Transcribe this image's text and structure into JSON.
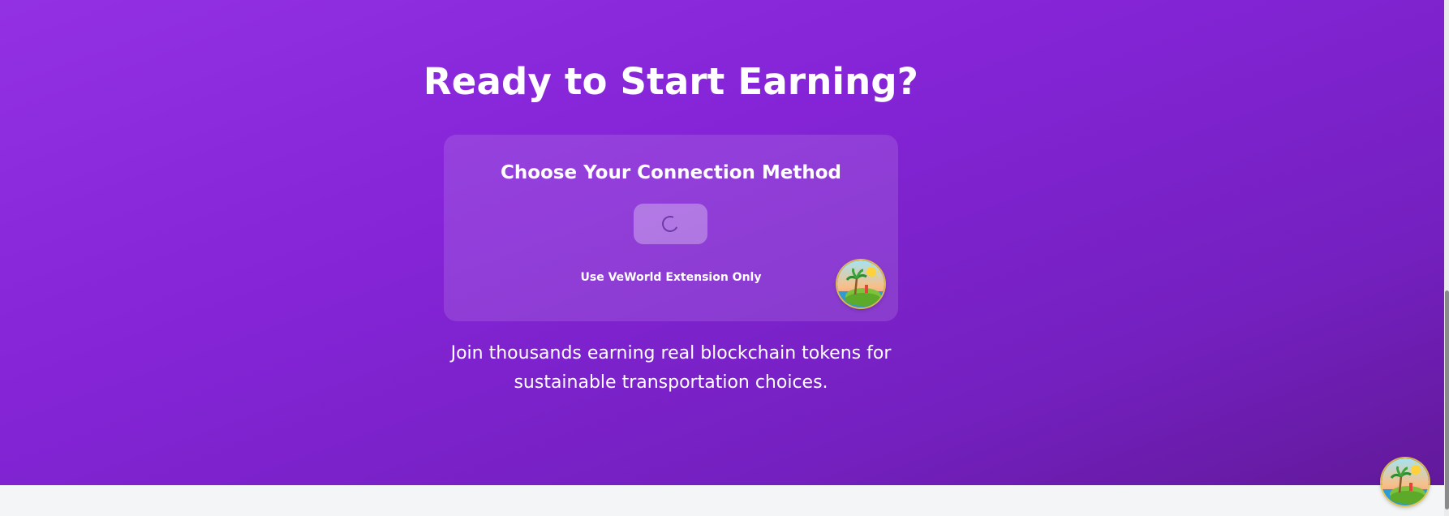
{
  "hero": {
    "headline": "Ready to Start Earning?",
    "subtext": "Join thousands earning real blockchain tokens for sustainable transportation choices."
  },
  "connect_card": {
    "title": "Choose Your Connection Method",
    "button_state": "loading",
    "extension_note": "Use VeWorld Extension Only"
  },
  "icons": {
    "spinner": "loading-spinner-icon",
    "badge": "island-avatar-icon"
  },
  "colors": {
    "gradient_start": "#9330e4",
    "gradient_end": "#62199a",
    "text": "#ffffff",
    "footer_bg": "#f4f5f7"
  }
}
